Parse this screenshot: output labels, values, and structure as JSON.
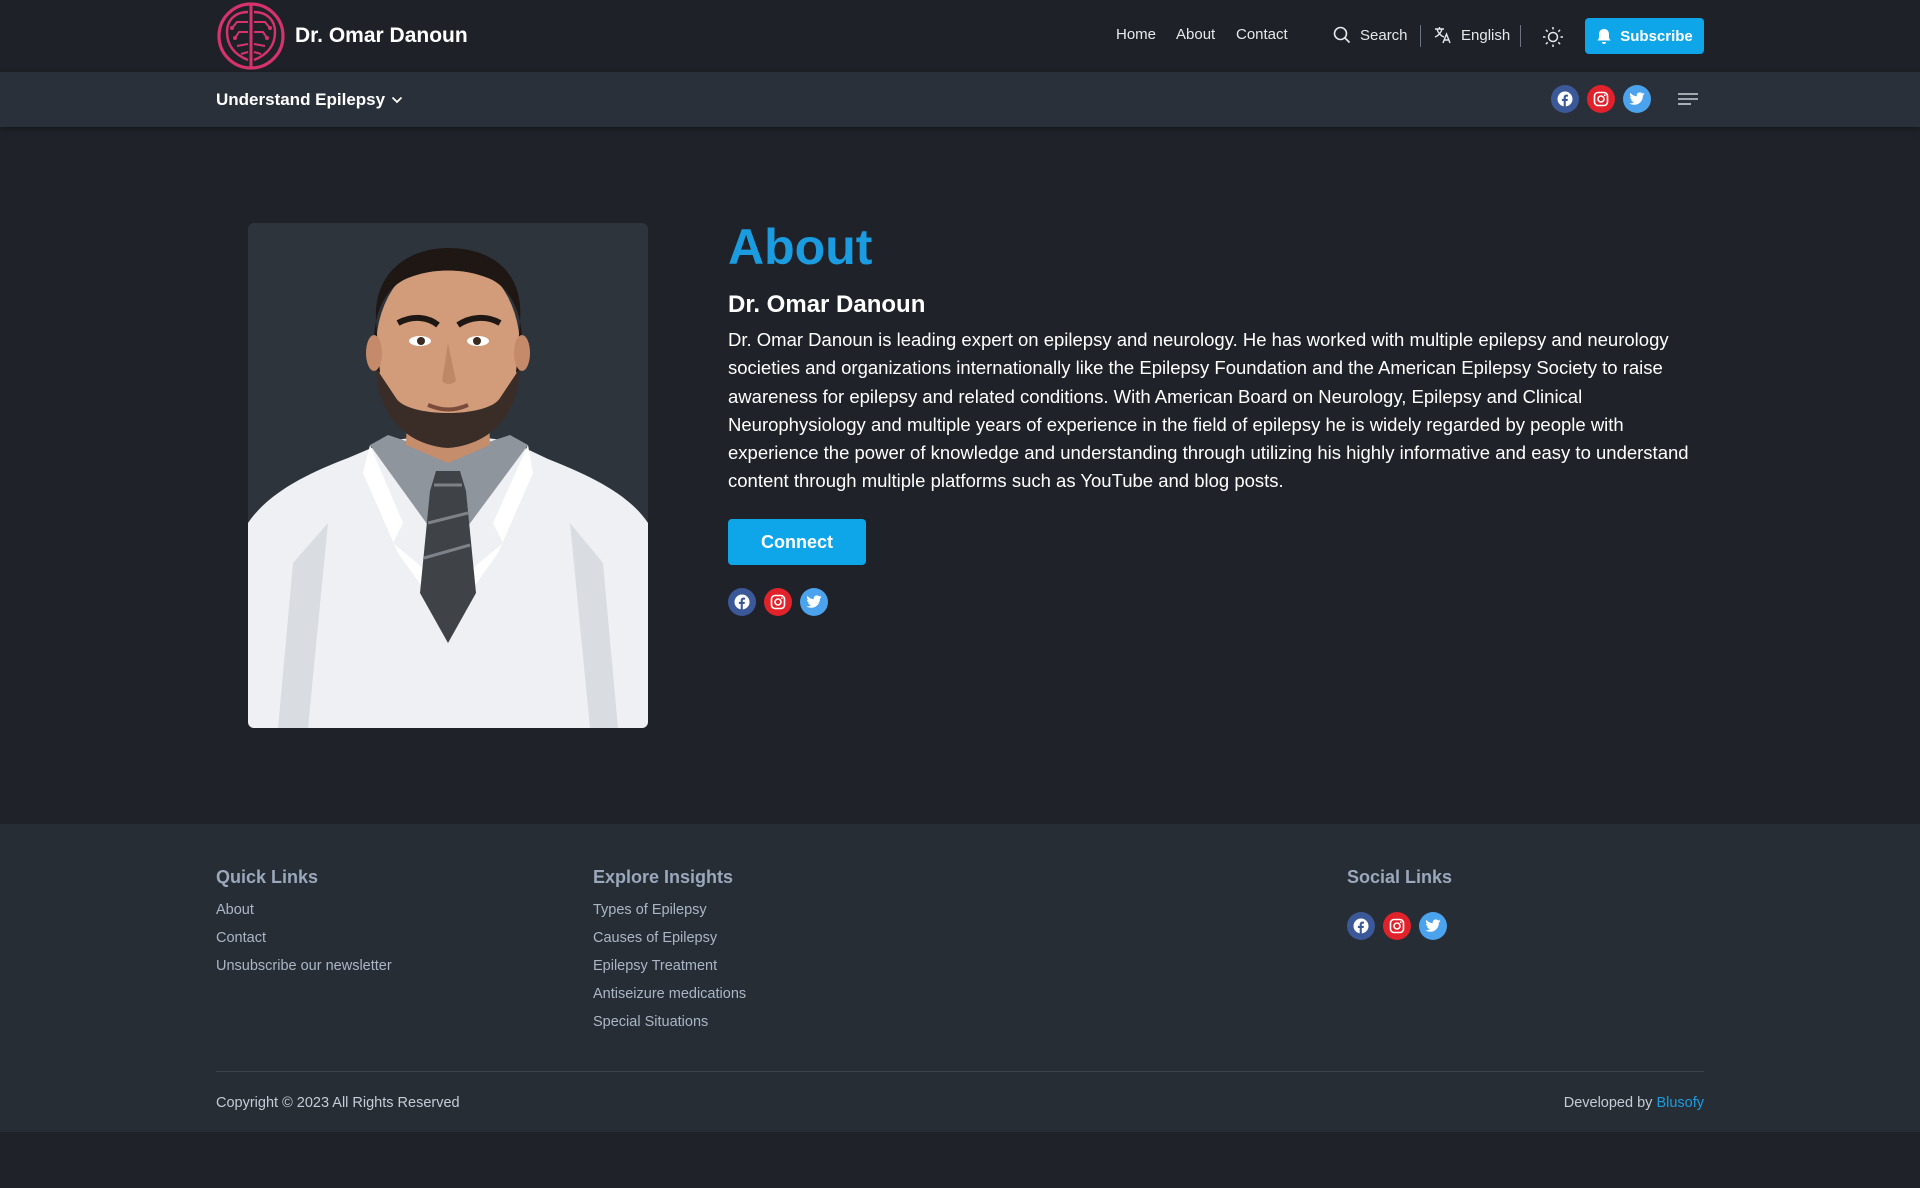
{
  "brand": {
    "name": "Dr. Omar Danoun",
    "logo_icon": "brain-icon",
    "logo_color": "#d6336c"
  },
  "nav": {
    "home": "Home",
    "about": "About",
    "contact": "Contact"
  },
  "search": {
    "label": "Search",
    "icon": "search-icon"
  },
  "language": {
    "label": "English",
    "icon": "translate-icon"
  },
  "theme_toggle": {
    "icon": "sun-icon"
  },
  "subscribe": {
    "label": "Subscribe",
    "icon": "bell-icon",
    "color": "#0ea5e9"
  },
  "subnav": {
    "understand_label": "Understand Epilepsy",
    "menu_icon": "hamburger-menu-icon"
  },
  "social": {
    "facebook_color": "#3b5998",
    "instagram_color": "#e1222b",
    "twitter_color": "#4aa3ec"
  },
  "about": {
    "title": "About",
    "name": "Dr. Omar Danoun",
    "bio": "Dr. Omar Danoun is leading expert on epilepsy and neurology. He has worked with multiple epilepsy and neurology societies and organizations internationally like the Epilepsy Foundation and the American Epilepsy Society to raise awareness for epilepsy and related conditions. With American Board on Neurology, Epilepsy and Clinical Neurophysiology and multiple years of experience in the field of epilepsy he is widely regarded by people with experience the power of knowledge and understanding through utilizing his highly informative and easy to understand content through multiple platforms such as YouTube and blog posts.",
    "connect_label": "Connect",
    "accent_color": "#1b9be0"
  },
  "footer": {
    "quick_links": {
      "title": "Quick Links",
      "items": [
        "About",
        "Contact",
        "Unsubscribe our newsletter"
      ]
    },
    "explore": {
      "title": "Explore Insights",
      "items": [
        "Types of Epilepsy",
        "Causes of Epilepsy",
        "Epilepsy Treatment",
        "Antiseizure medications",
        "Special Situations"
      ]
    },
    "social_links": {
      "title": "Social Links"
    },
    "copyright": "Copyright © 2023 All Rights Reserved",
    "developed_by": "Developed by",
    "developer": "Blusofy"
  }
}
